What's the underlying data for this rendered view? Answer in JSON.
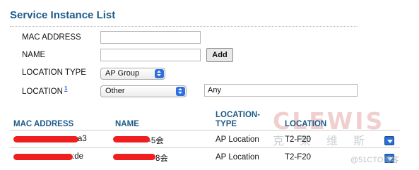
{
  "title": "Service Instance List",
  "form": {
    "mac_label": "MAC ADDRESS",
    "mac_value": "",
    "name_label": "NAME",
    "name_value": "",
    "add_label": "Add",
    "location_type_label": "LOCATION TYPE",
    "location_type_value": "AP Group",
    "location_label": "LOCATION",
    "location_info_mark": "1",
    "location_value": "Other",
    "location_text": "Any"
  },
  "table": {
    "headers": {
      "mac": "MAC ADDRESS",
      "name": "NAME",
      "location_type_line1": "LOCATION-",
      "location_type_line2": "TYPE",
      "location": "LOCATION"
    },
    "rows": [
      {
        "mac_visible": "a3",
        "name_visible": "-5会",
        "location_type": "AP Location",
        "location": "T2-F20"
      },
      {
        "mac_visible": ":de",
        "name_visible": "8会",
        "location_type": "AP Location",
        "location": "T2-F20"
      }
    ]
  },
  "watermark": {
    "main": "CLEWIS",
    "sub": "克莱维斯",
    "credit": "@51CTO博客"
  },
  "colors": {
    "heading": "#1d5b8a",
    "redaction": "#f01f1f",
    "dropdown_blue": "#2a6fd0"
  }
}
